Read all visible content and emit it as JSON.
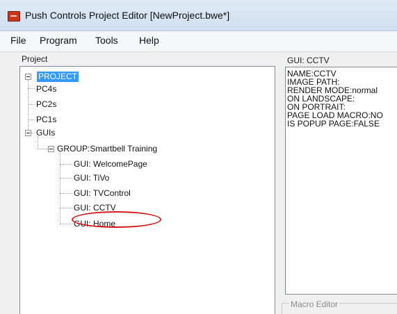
{
  "window": {
    "title": "Push Controls Project Editor [NewProject.bwe*]"
  },
  "menu": [
    "File",
    "Program",
    "Tools",
    "Help"
  ],
  "project_panel": {
    "label": "Project",
    "tree": [
      {
        "label": "PROJECT",
        "level": 0,
        "expanded": true,
        "selected": true
      },
      {
        "label": "PC4s",
        "level": 1
      },
      {
        "label": "PC2s",
        "level": 1
      },
      {
        "label": "PC1s",
        "level": 1
      },
      {
        "label": "GUIs",
        "level": 1,
        "expanded": true
      },
      {
        "label": "GROUP:Smartbell Training",
        "level": 2,
        "expanded": true
      },
      {
        "label": "GUI: WelcomePage",
        "level": 3
      },
      {
        "label": "GUI: TiVo",
        "level": 3
      },
      {
        "label": "GUI: TVControl",
        "level": 3
      },
      {
        "label": "GUI: CCTV",
        "level": 3
      },
      {
        "label": "GUI: Home",
        "level": 3,
        "circled": true
      }
    ]
  },
  "gui_panel": {
    "label": "GUI: CCTV",
    "properties": [
      "NAME:CCTV",
      "IMAGE PATH:",
      "RENDER MODE:normal",
      "ON LANDSCAPE:",
      "ON PORTRAIT:",
      "PAGE LOAD MACRO:NO",
      "IS POPUP PAGE:FALSE"
    ]
  },
  "macro_editor": {
    "label": "Macro Editor"
  },
  "colors": {
    "selection": "#3399ff",
    "annotation": "#d41b1b"
  }
}
